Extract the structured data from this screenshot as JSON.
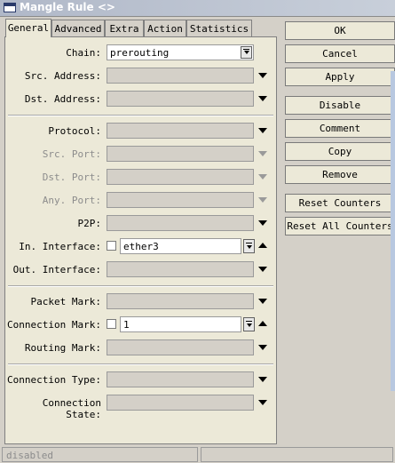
{
  "window": {
    "title": "Mangle Rule <>"
  },
  "tabs": [
    "General",
    "Advanced",
    "Extra",
    "Action",
    "Statistics"
  ],
  "fields": {
    "chain": {
      "label": "Chain:",
      "value": "prerouting"
    },
    "src_address": {
      "label": "Src. Address:"
    },
    "dst_address": {
      "label": "Dst. Address:"
    },
    "protocol": {
      "label": "Protocol:"
    },
    "src_port": {
      "label": "Src. Port:"
    },
    "dst_port": {
      "label": "Dst. Port:"
    },
    "any_port": {
      "label": "Any. Port:"
    },
    "p2p": {
      "label": "P2P:"
    },
    "in_interface": {
      "label": "In. Interface:",
      "value": "ether3"
    },
    "out_interface": {
      "label": "Out. Interface:"
    },
    "packet_mark": {
      "label": "Packet Mark:"
    },
    "connection_mark": {
      "label": "Connection Mark:",
      "value": "1"
    },
    "routing_mark": {
      "label": "Routing Mark:"
    },
    "connection_type": {
      "label": "Connection Type:"
    },
    "connection_state": {
      "label": "Connection State:"
    }
  },
  "buttons": {
    "ok": "OK",
    "cancel": "Cancel",
    "apply": "Apply",
    "disable": "Disable",
    "comment": "Comment",
    "copy": "Copy",
    "remove": "Remove",
    "reset_counters": "Reset Counters",
    "reset_all_counters": "Reset All Counters"
  },
  "status": {
    "text": "disabled"
  }
}
